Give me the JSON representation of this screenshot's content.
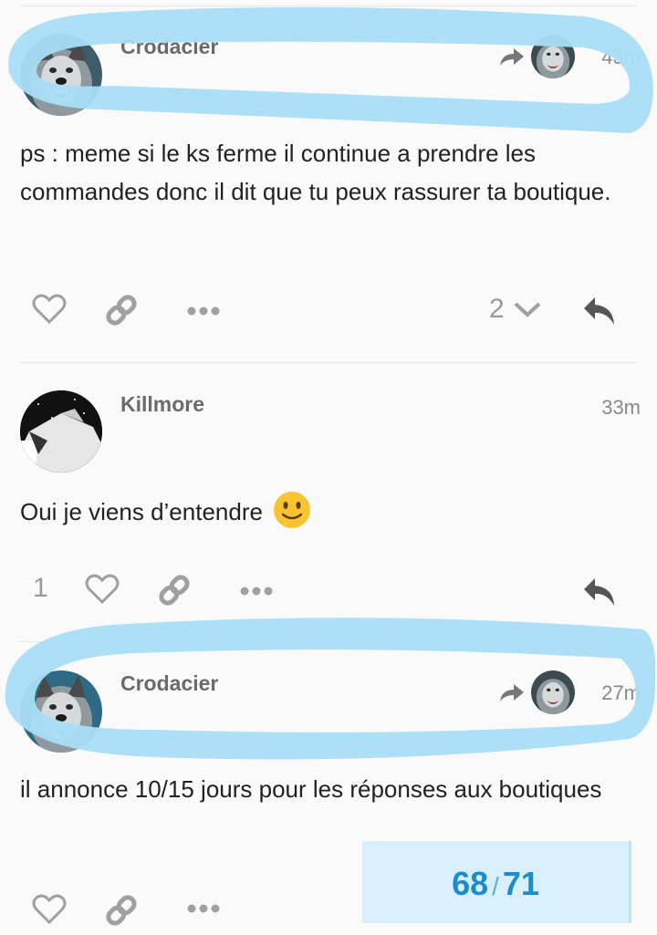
{
  "posts": [
    {
      "username": "Crodacier",
      "time": "43m",
      "has_reply_to": true,
      "body": "ps : meme si le ks ferme il continue a prendre les commandes donc il dit que tu peux rassurer ta boutique.",
      "like_count": "",
      "replies_count": "2"
    },
    {
      "username": "Killmore",
      "time": "33m",
      "has_reply_to": false,
      "body": "Oui je viens d’entendre",
      "emoji": "slightly-smiling-face",
      "like_count": "1",
      "replies_count": ""
    },
    {
      "username": "Crodacier",
      "time": "27m",
      "has_reply_to": true,
      "body": "il annonce 10/15 jours pour les réponses aux boutiques",
      "like_count": "",
      "replies_count": ""
    }
  ],
  "progress": {
    "current": "68",
    "separator": "/",
    "total": "71"
  },
  "colors": {
    "highlight": "#a9def6",
    "accent": "#1b8ccc",
    "progress_bg": "#d8f0fc"
  },
  "icons": [
    "heart-icon",
    "link-icon",
    "more-icon",
    "chevron-down-icon",
    "reply-icon",
    "reply-to-arrow-icon",
    "smile-emoji"
  ]
}
